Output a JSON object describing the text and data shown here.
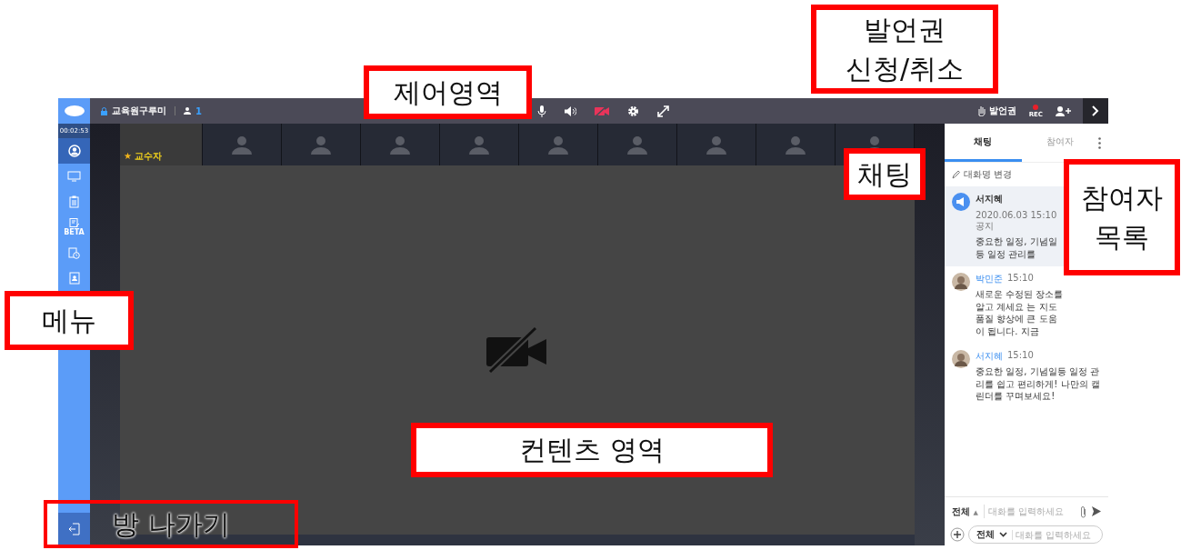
{
  "room": {
    "title": "교육원구루미",
    "participants": "1"
  },
  "timer": "00:02:53",
  "sidebar": {
    "items": [
      {
        "kind": "profile",
        "selected": true
      },
      {
        "kind": "screen",
        "selected": false
      },
      {
        "kind": "clipboard",
        "selected": false
      },
      {
        "kind": "note",
        "label": "BETA",
        "selected": false
      },
      {
        "kind": "schedule",
        "selected": false
      },
      {
        "kind": "contact",
        "selected": false
      }
    ]
  },
  "toolbar": [
    {
      "kind": "mic"
    },
    {
      "kind": "speaker"
    },
    {
      "kind": "camera-off"
    },
    {
      "kind": "settings"
    },
    {
      "kind": "expand"
    }
  ],
  "right_bar": {
    "floor_button": "발언권",
    "rec": "REC"
  },
  "tiles": [
    {
      "kind": "video",
      "badge": "★",
      "name": "교수자"
    },
    {
      "kind": "empty"
    },
    {
      "kind": "empty"
    },
    {
      "kind": "empty"
    },
    {
      "kind": "empty"
    },
    {
      "kind": "empty"
    },
    {
      "kind": "empty"
    },
    {
      "kind": "empty"
    },
    {
      "kind": "empty"
    },
    {
      "kind": "empty"
    }
  ],
  "chat": {
    "tabs": [
      {
        "label": "채팅",
        "selected": true
      },
      {
        "label": "참여자",
        "selected": false
      }
    ],
    "rename": "대화명 변경",
    "messages": [
      {
        "kind": "notice",
        "author": "서지혜",
        "time": "2020.06.03 15:10 공지",
        "text": "중요한 일정, 기념일등 일정 관리를"
      },
      {
        "kind": "message",
        "author": "박민준",
        "time": "15:10",
        "text": "새로운 수정된 장소를 알고 계세요 는 지도 품질 향상에 큰 도움이 됩니다. 지금"
      },
      {
        "kind": "message",
        "author": "서지혜",
        "time": "15:10",
        "text": "중요한 일정, 기념일등 일정 관리를 쉽고 편리하게! 나만의 캘린더를 꾸며보세요!"
      }
    ],
    "target": "전체",
    "target_arrow": "▲",
    "placeholder": "대화를 입력하세요",
    "second_row": {
      "target": "전체",
      "placeholder": "대화를 입력하세요"
    }
  },
  "annotations": [
    {
      "text": "제어영역",
      "filled": true
    },
    {
      "text": "발언권\n신청/취소",
      "filled": true
    },
    {
      "text": "채팅",
      "filled": true
    },
    {
      "text": "참여자\n목록",
      "filled": true
    },
    {
      "text": "메뉴",
      "filled": true
    },
    {
      "text": "컨텐츠 영역",
      "filled": true
    },
    {
      "text": "방 나가기",
      "filled": false
    }
  ]
}
